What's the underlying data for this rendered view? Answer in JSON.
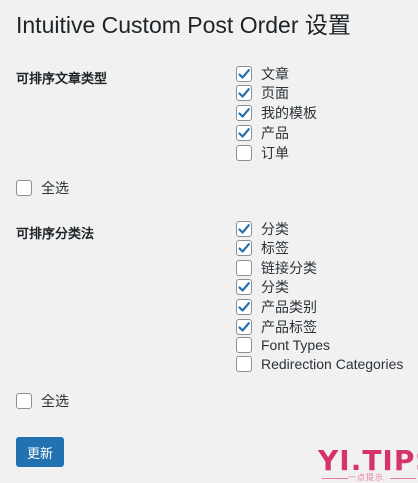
{
  "title": "Intuitive Custom Post Order 设置",
  "post_types": {
    "label": "可排序文章类型",
    "items": [
      {
        "label": "文章",
        "checked": true
      },
      {
        "label": "页面",
        "checked": true
      },
      {
        "label": "我的模板",
        "checked": true
      },
      {
        "label": "产品",
        "checked": true
      },
      {
        "label": "订单",
        "checked": false
      }
    ],
    "select_all": {
      "label": "全选",
      "checked": false
    }
  },
  "taxonomies": {
    "label": "可排序分类法",
    "items": [
      {
        "label": "分类",
        "checked": true
      },
      {
        "label": "标签",
        "checked": true
      },
      {
        "label": "链接分类",
        "checked": false
      },
      {
        "label": "分类",
        "checked": true
      },
      {
        "label": "产品类别",
        "checked": true
      },
      {
        "label": "产品标签",
        "checked": true
      },
      {
        "label": "Font Types",
        "checked": false
      },
      {
        "label": "Redirection Categories",
        "checked": false
      }
    ],
    "select_all": {
      "label": "全选",
      "checked": false
    }
  },
  "submit_label": "更新",
  "watermark": {
    "main": "YI.TIPS",
    "sub": "一点提示"
  },
  "colors": {
    "accent": "#2271b1",
    "check": "#2271b1",
    "watermark": "#d6336c"
  }
}
